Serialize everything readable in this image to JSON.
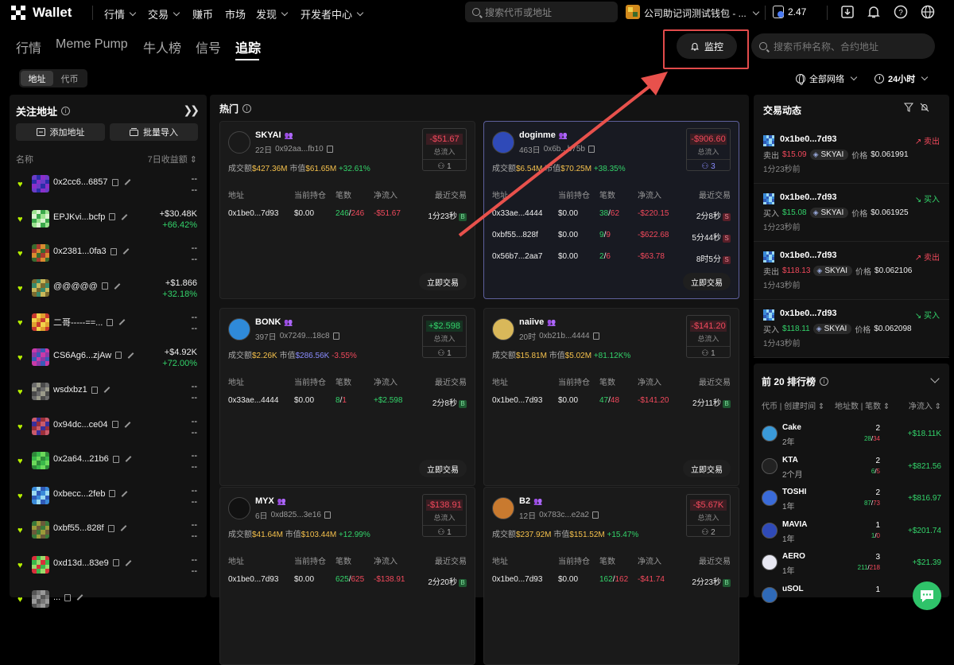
{
  "app": {
    "logo_text": "Wallet"
  },
  "top_nav": [
    {
      "label": "行情",
      "has_chevron": true
    },
    {
      "label": "交易",
      "has_chevron": true
    },
    {
      "label": "赚币",
      "has_chevron": false
    },
    {
      "label": "市场",
      "has_chevron": false
    },
    {
      "label": "发现",
      "has_chevron": true
    },
    {
      "label": "开发者中心",
      "has_chevron": true
    }
  ],
  "top_search": {
    "placeholder": "搜索代币或地址"
  },
  "wallet": {
    "name": "公司助记词测试钱包 - ...",
    "balance": "2.47"
  },
  "sub_tabs": [
    "行情",
    "Meme Pump",
    "牛人榜",
    "信号",
    "追踪"
  ],
  "active_sub_tab": "追踪",
  "monitor_button": "监控",
  "token_search": {
    "placeholder": "搜索币种名称、合约地址"
  },
  "segment": [
    "地址",
    "代币"
  ],
  "network_filter": "全部网络",
  "time_filter": "24小时",
  "left_panel": {
    "title": "关注地址",
    "add_button": "添加地址",
    "import_button": "批量导入",
    "col_name": "名称",
    "col_pnl": "7日收益额",
    "items": [
      {
        "name": "0x2cc6...6857",
        "v1": "--",
        "v2": "--",
        "v2_color": "#eeeeee"
      },
      {
        "name": "EPJKvi...bcfp",
        "v1": "+$30.48K",
        "v2": "+66.42%",
        "v2_color": "#33d36a"
      },
      {
        "name": "0x2381...0fa3",
        "v1": "--",
        "v2": "--",
        "v2_color": "#eeeeee"
      },
      {
        "name": "@@@@@",
        "v1": "+$1.866",
        "v2": "+32.18%",
        "v2_color": "#33d36a"
      },
      {
        "name": "二哥-----==...",
        "v1": "--",
        "v2": "--",
        "v2_color": "#eeeeee"
      },
      {
        "name": "CS6Ag6...zjAw",
        "v1": "+$4.92K",
        "v2": "+72.00%",
        "v2_color": "#33d36a"
      },
      {
        "name": "wsdxbz1",
        "v1": "--",
        "v2": "--",
        "v2_color": "#eeeeee"
      },
      {
        "name": "0x94dc...ce04",
        "v1": "--",
        "v2": "--",
        "v2_color": "#eeeeee"
      },
      {
        "name": "0x2a64...21b6",
        "v1": "--",
        "v2": "--",
        "v2_color": "#eeeeee"
      },
      {
        "name": "0xbecc...2feb",
        "v1": "--",
        "v2": "--",
        "v2_color": "#eeeeee"
      },
      {
        "name": "0xbf55...828f",
        "v1": "--",
        "v2": "--",
        "v2_color": "#eeeeee"
      },
      {
        "name": "0xd13d...83e9",
        "v1": "--",
        "v2": "--",
        "v2_color": "#eeeeee"
      },
      {
        "name": "...",
        "v1": "",
        "v2": "",
        "v2_color": "#eeeeee"
      }
    ]
  },
  "hot": {
    "title": "热门",
    "col_headers": [
      "地址",
      "当前持仓",
      "笔数",
      "净流入",
      "最近交易"
    ],
    "trade_button": "立即交易",
    "inflow_label": "总流入",
    "cards": [
      {
        "name": "SKYAI",
        "age": "22日",
        "addr": "0x92aa...fb10",
        "vol_label": "成交额",
        "vol": "$427.36M",
        "mc_label": "市值",
        "mc": "$61.65M",
        "chg": "+32.61%",
        "chg_color": "#33d36a",
        "inflow": "-$51.67",
        "inflow_pos": false,
        "count": "1",
        "rows": [
          {
            "addr": "0x1be0...7d93",
            "hold": "$0.00",
            "n1": "246",
            "n2": "246",
            "flow": "-$51.67",
            "flow_pos": false,
            "last": "1分23秒",
            "side": "B"
          }
        ]
      },
      {
        "name": "doginme",
        "age": "463日",
        "addr": "0x6b...b75b",
        "vol_label": "成交额",
        "vol": "$6.54M",
        "mc_label": "市值",
        "mc": "$70.25M",
        "chg": "+38.35%",
        "chg_color": "#33d36a",
        "inflow": "-$906.60",
        "inflow_pos": false,
        "count": "3",
        "rows": [
          {
            "addr": "0x33ae...4444",
            "hold": "$0.00",
            "n1": "38",
            "n2": "62",
            "flow": "-$220.15",
            "flow_pos": false,
            "last": "2分8秒",
            "side": "S"
          },
          {
            "addr": "0xbf55...828f",
            "hold": "$0.00",
            "n1": "9",
            "n2": "9",
            "flow": "-$622.68",
            "flow_pos": false,
            "last": "5分44秒",
            "side": "S"
          },
          {
            "addr": "0x56b7...2aa7",
            "hold": "$0.00",
            "n1": "2",
            "n2": "6",
            "flow": "-$63.78",
            "flow_pos": false,
            "last": "8时5分",
            "side": "S"
          }
        ]
      },
      {
        "name": "BONK",
        "age": "397日",
        "addr": "0x7249...18c8",
        "vol_label": "成交额",
        "vol": "$2.26K",
        "mc_label": "市值",
        "mc": "$286.56K",
        "chg": "-3.55%",
        "chg_color": "#f2495c",
        "inflow": "+$2.598",
        "inflow_pos": true,
        "count": "1",
        "rows": [
          {
            "addr": "0x33ae...4444",
            "hold": "$0.00",
            "n1": "8",
            "n2": "1",
            "flow": "+$2.598",
            "flow_pos": true,
            "last": "2分8秒",
            "side": "B"
          }
        ]
      },
      {
        "name": "naiive",
        "age": "20时",
        "addr": "0xb21b...4444",
        "vol_label": "成交额",
        "vol": "$15.81M",
        "mc_label": "市值",
        "mc": "$5.02M",
        "chg": "+81.12K%",
        "chg_color": "#33d36a",
        "inflow": "-$141.20",
        "inflow_pos": false,
        "count": "1",
        "rows": [
          {
            "addr": "0x1be0...7d93",
            "hold": "$0.00",
            "n1": "47",
            "n2": "48",
            "flow": "-$141.20",
            "flow_pos": false,
            "last": "2分11秒",
            "side": "B"
          }
        ]
      },
      {
        "name": "MYX",
        "age": "6日",
        "addr": "0xd825...3e16",
        "vol_label": "成交额",
        "vol": "$41.64M",
        "mc_label": "市值",
        "mc": "$103.44M",
        "chg": "+12.99%",
        "chg_color": "#33d36a",
        "inflow": "-$138.91",
        "inflow_pos": false,
        "count": "1",
        "rows": [
          {
            "addr": "0x1be0...7d93",
            "hold": "$0.00",
            "n1": "625",
            "n2": "625",
            "flow": "-$138.91",
            "flow_pos": false,
            "last": "2分20秒",
            "side": "B"
          }
        ]
      },
      {
        "name": "B2",
        "age": "12日",
        "addr": "0x783c...e2a2",
        "vol_label": "成交额",
        "vol": "$237.92M",
        "mc_label": "市值",
        "mc": "$151.52M",
        "chg": "+15.47%",
        "chg_color": "#33d36a",
        "inflow": "-$5.67K",
        "inflow_pos": false,
        "count": "2",
        "rows": [
          {
            "addr": "0x1be0...7d93",
            "hold": "$0.00",
            "n1": "162",
            "n2": "162",
            "flow": "-$41.74",
            "flow_pos": false,
            "last": "2分23秒",
            "side": "B"
          }
        ]
      }
    ]
  },
  "activity": {
    "title": "交易动态",
    "items": [
      {
        "addr": "0x1be0...7d93",
        "side": "卖出",
        "is_sell": true,
        "verb": "卖出",
        "amount": "$15.09",
        "token": "SKYAI",
        "price_label": "价格",
        "price": "$0.061991",
        "time": "1分23秒前"
      },
      {
        "addr": "0x1be0...7d93",
        "side": "买入",
        "is_sell": false,
        "verb": "买入",
        "amount": "$15.08",
        "token": "SKYAI",
        "price_label": "价格",
        "price": "$0.061925",
        "time": "1分23秒前"
      },
      {
        "addr": "0x1be0...7d93",
        "side": "卖出",
        "is_sell": true,
        "verb": "卖出",
        "amount": "$118.13",
        "token": "SKYAI",
        "price_label": "价格",
        "price": "$0.062106",
        "time": "1分43秒前"
      },
      {
        "addr": "0x1be0...7d93",
        "side": "买入",
        "is_sell": false,
        "verb": "买入",
        "amount": "$118.11",
        "token": "SKYAI",
        "price_label": "价格",
        "price": "$0.062098",
        "time": "1分43秒前"
      }
    ]
  },
  "ranking": {
    "title": "前 20 排行榜",
    "col1": "代币 | 创建时间",
    "col2": "地址数 | 笔数",
    "col3": "净流入",
    "items": [
      {
        "name": "Cake",
        "age": "2年",
        "addrs": "2",
        "n1": "28",
        "n2": "34",
        "net": "+$18.11K"
      },
      {
        "name": "KTA",
        "age": "2个月",
        "addrs": "2",
        "n1": "6",
        "n2": "5",
        "net": "+$821.56"
      },
      {
        "name": "TOSHI",
        "age": "1年",
        "addrs": "2",
        "n1": "87",
        "n2": "73",
        "net": "+$816.97"
      },
      {
        "name": "MAVIA",
        "age": "1年",
        "addrs": "1",
        "n1": "1",
        "n2": "0",
        "net": "+$201.74"
      },
      {
        "name": "AERO",
        "age": "1年",
        "addrs": "3",
        "n1": "211",
        "n2": "218",
        "net": "+$21.39"
      },
      {
        "name": "uSOL",
        "age": "",
        "addrs": "1",
        "n1": "",
        "n2": "",
        "net": ""
      }
    ]
  }
}
